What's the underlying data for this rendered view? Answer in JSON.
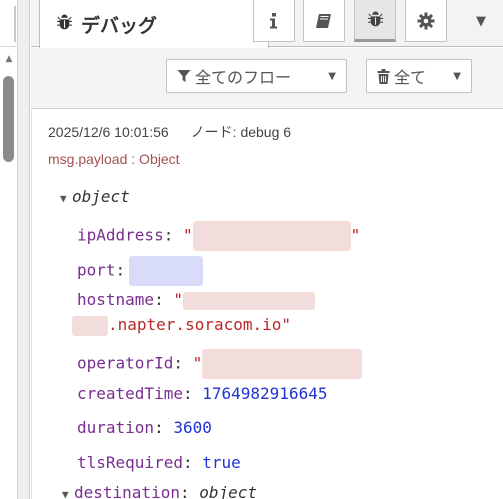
{
  "header": {
    "tab_label": "デバッグ",
    "tab_icon": "bug-icon",
    "buttons": [
      {
        "name": "info-button",
        "icon": "info-icon"
      },
      {
        "name": "help-button",
        "icon": "book-icon"
      },
      {
        "name": "debug-button",
        "icon": "bug-icon",
        "selected": true
      },
      {
        "name": "config-button",
        "icon": "gear-icon"
      }
    ],
    "menu_icon": "caret-down-icon"
  },
  "toolbar": {
    "filter_label": "全てのフロー",
    "clear_label": "全て"
  },
  "message": {
    "timestamp": "2025/12/6 10:01:56",
    "node": "ノード: debug 6",
    "topic": "msg.payload : Object",
    "root_label": "object",
    "fields": [
      {
        "key": "ipAddress",
        "value": "\"",
        "value_end": "\"",
        "type": "string"
      },
      {
        "key": "port",
        "value": "",
        "type": "number"
      },
      {
        "key": "hostname",
        "value": "\"",
        "value_cont": ".napter.soracom.io\"",
        "type": "string"
      },
      {
        "key": "operatorId",
        "value": "\"",
        "type": "string"
      },
      {
        "key": "createdTime",
        "value": "1764982916645",
        "type": "number"
      },
      {
        "key": "duration",
        "value": "3600",
        "type": "number"
      },
      {
        "key": "tlsRequired",
        "value": "true",
        "type": "boolean"
      },
      {
        "key": "destination",
        "value": "object",
        "type": "object"
      }
    ]
  },
  "colors": {
    "key": "#792e90",
    "string": "#b72828",
    "number": "#2033d6",
    "topic": "#a25151"
  }
}
